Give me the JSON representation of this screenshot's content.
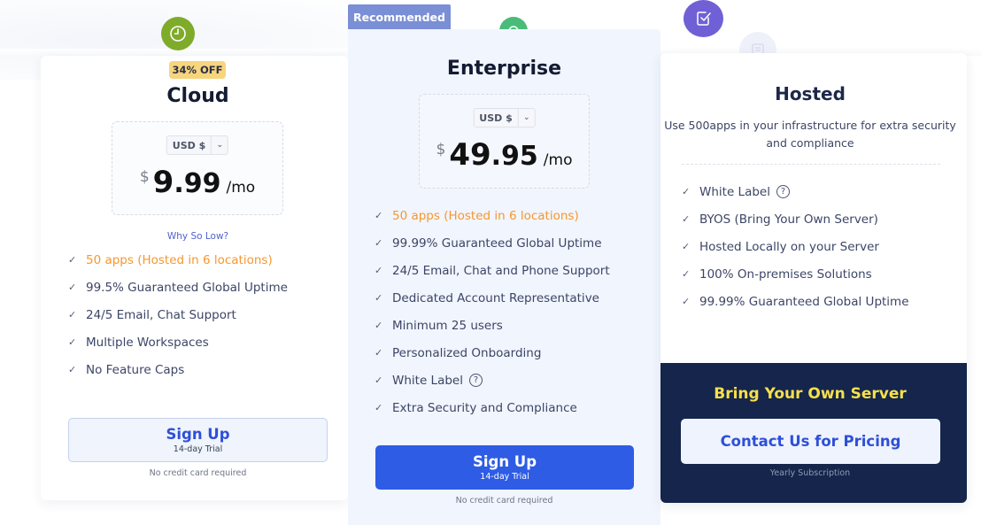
{
  "badges": {
    "recommended": "Recommended",
    "discount": "34% OFF"
  },
  "plans": {
    "cloud": {
      "icon": "clock-icon",
      "title": "Cloud",
      "currency": "USD $",
      "price_symbol": "$",
      "price_whole": "9",
      "price_cents": ".99",
      "price_period": "/mo",
      "why_link": "Why So Low?",
      "features": [
        "50 apps (Hosted in 6 locations)",
        "99.5% Guaranteed Global Uptime",
        "24/5 Email, Chat Support",
        "Multiple Workspaces",
        "No Feature Caps"
      ],
      "button_label": "Sign Up",
      "button_sub": "14-day Trial",
      "note": "No credit card required"
    },
    "enterprise": {
      "icon": "badge-icon",
      "title": "Enterprise",
      "currency": "USD $",
      "price_symbol": "$",
      "price_whole": "49",
      "price_cents": ".95",
      "price_period": "/mo",
      "features": [
        "50 apps (Hosted in 6 locations)",
        "99.99% Guaranteed Global Uptime",
        "24/5 Email, Chat and Phone Support",
        "Dedicated Account Representative",
        "Minimum 25 users",
        "Personalized Onboarding",
        "White Label",
        "Extra Security and Compliance"
      ],
      "button_label": "Sign Up",
      "button_sub": "14-day Trial",
      "note": "No credit card required"
    },
    "hosted": {
      "icon": "checkbox-icon",
      "title": "Hosted",
      "description": "Use 500apps in your infrastructure for extra security and compliance",
      "features": [
        "White Label",
        "BYOS (Bring Your Own Server)",
        "Hosted Locally on your Server",
        "100% On-premises Solutions",
        "99.99% Guaranteed Global Uptime"
      ],
      "panel_title": "Bring Your Own Server",
      "button_label": "Contact Us for Pricing",
      "note": "Yearly Subscription"
    }
  },
  "colors": {
    "accent_blue": "#2e5ce4",
    "highlight_orange": "#f6972f",
    "byos_yellow": "#f6e04a",
    "byos_navy": "#15254b",
    "recommended_bg": "#7b8fd6"
  }
}
